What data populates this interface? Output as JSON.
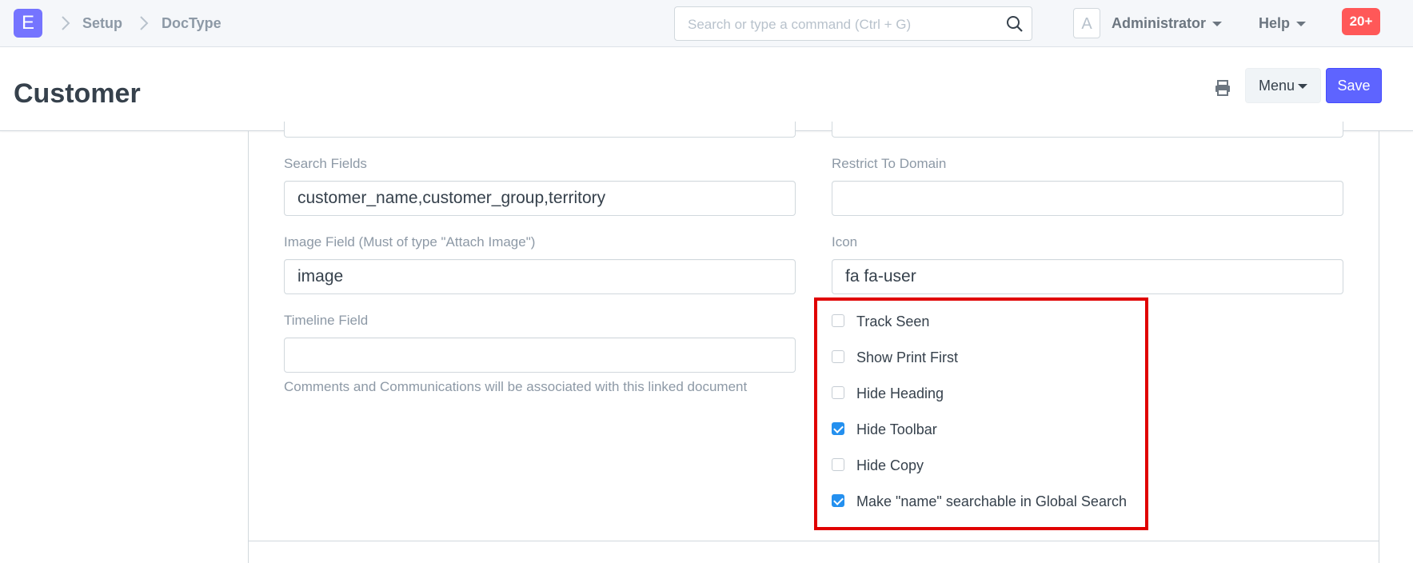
{
  "navbar": {
    "logo_letter": "E",
    "breadcrumbs": [
      "Setup",
      "DocType"
    ],
    "search_placeholder": "Search or type a command (Ctrl + G)",
    "avatar_letter": "A",
    "user_label": "Administrator",
    "help_label": "Help",
    "notification_count": "20+"
  },
  "page": {
    "title": "Customer",
    "menu_label": "Menu",
    "save_label": "Save"
  },
  "form": {
    "search_fields": {
      "label": "Search Fields",
      "value": "customer_name,customer_group,territory"
    },
    "restrict_to_domain": {
      "label": "Restrict To Domain",
      "value": ""
    },
    "image_field": {
      "label": "Image Field (Must of type \"Attach Image\")",
      "value": "image"
    },
    "icon": {
      "label": "Icon",
      "value": "fa fa-user"
    },
    "timeline_field": {
      "label": "Timeline Field",
      "value": "",
      "help": "Comments and Communications will be associated with this linked document"
    },
    "checkboxes": [
      {
        "label": "Track Seen",
        "checked": false
      },
      {
        "label": "Show Print First",
        "checked": false
      },
      {
        "label": "Hide Heading",
        "checked": false
      },
      {
        "label": "Hide Toolbar",
        "checked": true
      },
      {
        "label": "Hide Copy",
        "checked": false
      },
      {
        "label": "Make \"name\" searchable in Global Search",
        "checked": true
      }
    ]
  },
  "colors": {
    "primary": "#5e64ff",
    "logo": "#7574ff",
    "badge": "#ff5858",
    "checkbox_checked": "#2490ef",
    "highlight": "#e00000"
  }
}
